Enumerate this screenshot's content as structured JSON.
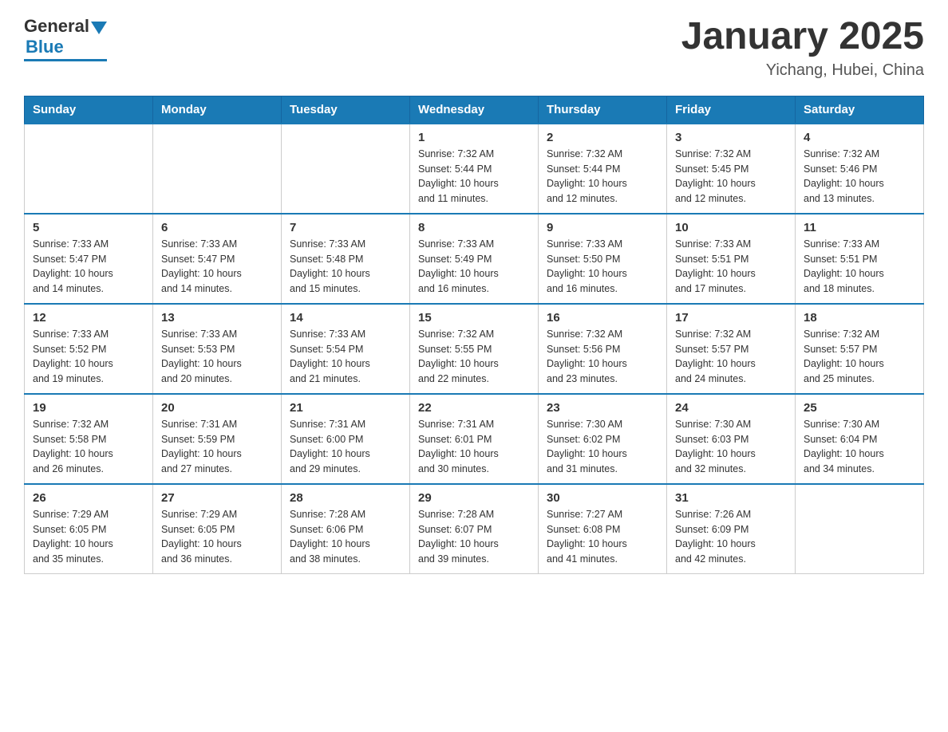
{
  "logo": {
    "general": "General",
    "blue": "Blue"
  },
  "title": "January 2025",
  "subtitle": "Yichang, Hubei, China",
  "days_of_week": [
    "Sunday",
    "Monday",
    "Tuesday",
    "Wednesday",
    "Thursday",
    "Friday",
    "Saturday"
  ],
  "weeks": [
    [
      {
        "day": "",
        "info": ""
      },
      {
        "day": "",
        "info": ""
      },
      {
        "day": "",
        "info": ""
      },
      {
        "day": "1",
        "info": "Sunrise: 7:32 AM\nSunset: 5:44 PM\nDaylight: 10 hours\nand 11 minutes."
      },
      {
        "day": "2",
        "info": "Sunrise: 7:32 AM\nSunset: 5:44 PM\nDaylight: 10 hours\nand 12 minutes."
      },
      {
        "day": "3",
        "info": "Sunrise: 7:32 AM\nSunset: 5:45 PM\nDaylight: 10 hours\nand 12 minutes."
      },
      {
        "day": "4",
        "info": "Sunrise: 7:32 AM\nSunset: 5:46 PM\nDaylight: 10 hours\nand 13 minutes."
      }
    ],
    [
      {
        "day": "5",
        "info": "Sunrise: 7:33 AM\nSunset: 5:47 PM\nDaylight: 10 hours\nand 14 minutes."
      },
      {
        "day": "6",
        "info": "Sunrise: 7:33 AM\nSunset: 5:47 PM\nDaylight: 10 hours\nand 14 minutes."
      },
      {
        "day": "7",
        "info": "Sunrise: 7:33 AM\nSunset: 5:48 PM\nDaylight: 10 hours\nand 15 minutes."
      },
      {
        "day": "8",
        "info": "Sunrise: 7:33 AM\nSunset: 5:49 PM\nDaylight: 10 hours\nand 16 minutes."
      },
      {
        "day": "9",
        "info": "Sunrise: 7:33 AM\nSunset: 5:50 PM\nDaylight: 10 hours\nand 16 minutes."
      },
      {
        "day": "10",
        "info": "Sunrise: 7:33 AM\nSunset: 5:51 PM\nDaylight: 10 hours\nand 17 minutes."
      },
      {
        "day": "11",
        "info": "Sunrise: 7:33 AM\nSunset: 5:51 PM\nDaylight: 10 hours\nand 18 minutes."
      }
    ],
    [
      {
        "day": "12",
        "info": "Sunrise: 7:33 AM\nSunset: 5:52 PM\nDaylight: 10 hours\nand 19 minutes."
      },
      {
        "day": "13",
        "info": "Sunrise: 7:33 AM\nSunset: 5:53 PM\nDaylight: 10 hours\nand 20 minutes."
      },
      {
        "day": "14",
        "info": "Sunrise: 7:33 AM\nSunset: 5:54 PM\nDaylight: 10 hours\nand 21 minutes."
      },
      {
        "day": "15",
        "info": "Sunrise: 7:32 AM\nSunset: 5:55 PM\nDaylight: 10 hours\nand 22 minutes."
      },
      {
        "day": "16",
        "info": "Sunrise: 7:32 AM\nSunset: 5:56 PM\nDaylight: 10 hours\nand 23 minutes."
      },
      {
        "day": "17",
        "info": "Sunrise: 7:32 AM\nSunset: 5:57 PM\nDaylight: 10 hours\nand 24 minutes."
      },
      {
        "day": "18",
        "info": "Sunrise: 7:32 AM\nSunset: 5:57 PM\nDaylight: 10 hours\nand 25 minutes."
      }
    ],
    [
      {
        "day": "19",
        "info": "Sunrise: 7:32 AM\nSunset: 5:58 PM\nDaylight: 10 hours\nand 26 minutes."
      },
      {
        "day": "20",
        "info": "Sunrise: 7:31 AM\nSunset: 5:59 PM\nDaylight: 10 hours\nand 27 minutes."
      },
      {
        "day": "21",
        "info": "Sunrise: 7:31 AM\nSunset: 6:00 PM\nDaylight: 10 hours\nand 29 minutes."
      },
      {
        "day": "22",
        "info": "Sunrise: 7:31 AM\nSunset: 6:01 PM\nDaylight: 10 hours\nand 30 minutes."
      },
      {
        "day": "23",
        "info": "Sunrise: 7:30 AM\nSunset: 6:02 PM\nDaylight: 10 hours\nand 31 minutes."
      },
      {
        "day": "24",
        "info": "Sunrise: 7:30 AM\nSunset: 6:03 PM\nDaylight: 10 hours\nand 32 minutes."
      },
      {
        "day": "25",
        "info": "Sunrise: 7:30 AM\nSunset: 6:04 PM\nDaylight: 10 hours\nand 34 minutes."
      }
    ],
    [
      {
        "day": "26",
        "info": "Sunrise: 7:29 AM\nSunset: 6:05 PM\nDaylight: 10 hours\nand 35 minutes."
      },
      {
        "day": "27",
        "info": "Sunrise: 7:29 AM\nSunset: 6:05 PM\nDaylight: 10 hours\nand 36 minutes."
      },
      {
        "day": "28",
        "info": "Sunrise: 7:28 AM\nSunset: 6:06 PM\nDaylight: 10 hours\nand 38 minutes."
      },
      {
        "day": "29",
        "info": "Sunrise: 7:28 AM\nSunset: 6:07 PM\nDaylight: 10 hours\nand 39 minutes."
      },
      {
        "day": "30",
        "info": "Sunrise: 7:27 AM\nSunset: 6:08 PM\nDaylight: 10 hours\nand 41 minutes."
      },
      {
        "day": "31",
        "info": "Sunrise: 7:26 AM\nSunset: 6:09 PM\nDaylight: 10 hours\nand 42 minutes."
      },
      {
        "day": "",
        "info": ""
      }
    ]
  ]
}
